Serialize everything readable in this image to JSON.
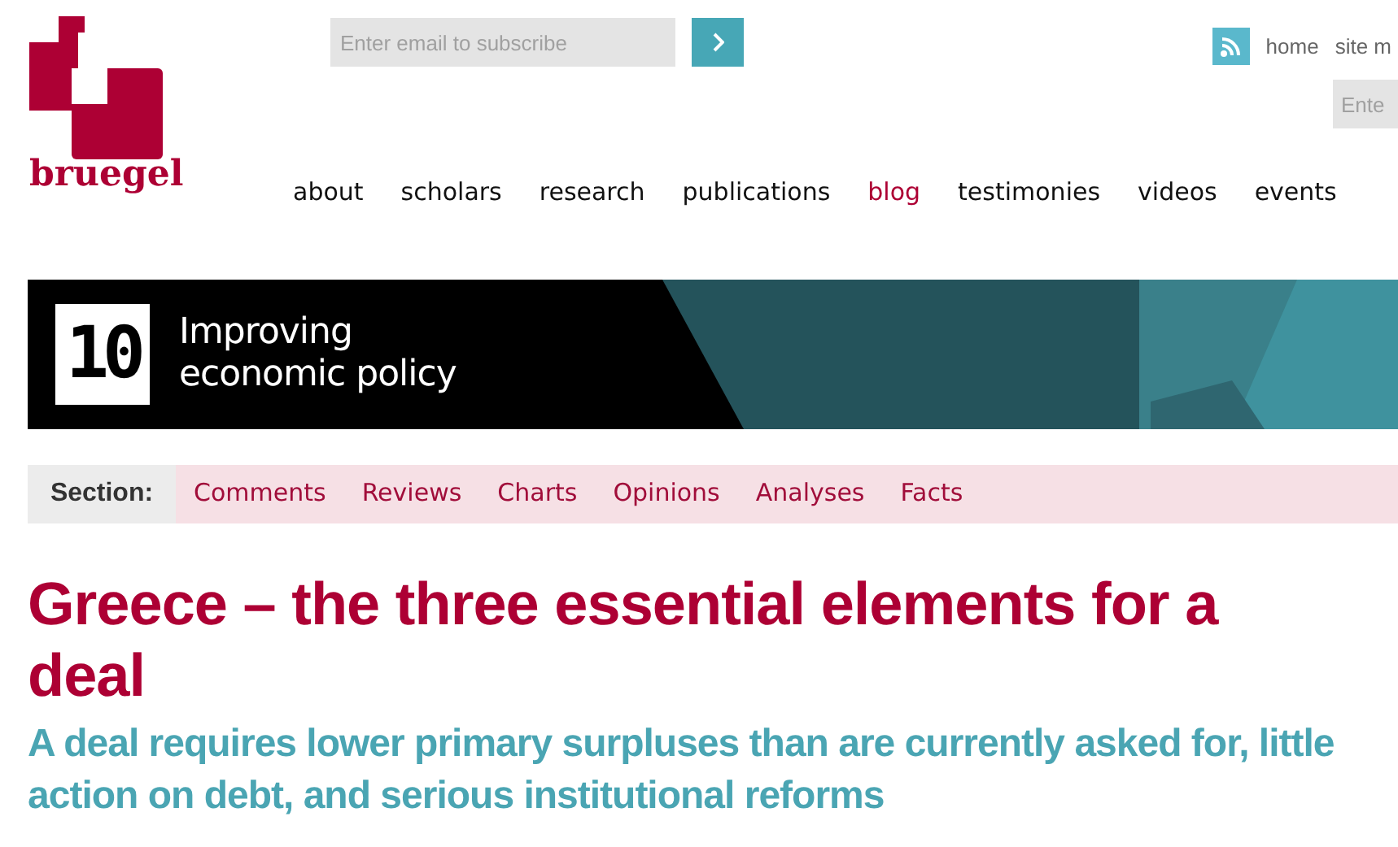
{
  "subscribe": {
    "placeholder": "Enter email to subscribe"
  },
  "top_links": [
    "home",
    "site m"
  ],
  "search": {
    "placeholder": "Ente"
  },
  "logo": {
    "text": "bruegel"
  },
  "nav": [
    {
      "label": "about",
      "selected": false
    },
    {
      "label": "scholars",
      "selected": false
    },
    {
      "label": "research",
      "selected": false
    },
    {
      "label": "publications",
      "selected": false
    },
    {
      "label": "blog",
      "selected": true
    },
    {
      "label": "testimonies",
      "selected": false
    },
    {
      "label": "videos",
      "selected": false
    },
    {
      "label": "events",
      "selected": false
    }
  ],
  "banner": {
    "badge": "10",
    "title_lines": [
      "Improving",
      "economic policy"
    ]
  },
  "section_bar": {
    "label": "Section:",
    "items": [
      "Comments",
      "Reviews",
      "Charts",
      "Opinions",
      "Analyses",
      "Facts"
    ]
  },
  "article": {
    "title": "Greece – the three essential elements for a deal",
    "subtitle": "A deal requires lower primary surpluses than are currently asked for, little action on debt, and serious institutional reforms"
  }
}
